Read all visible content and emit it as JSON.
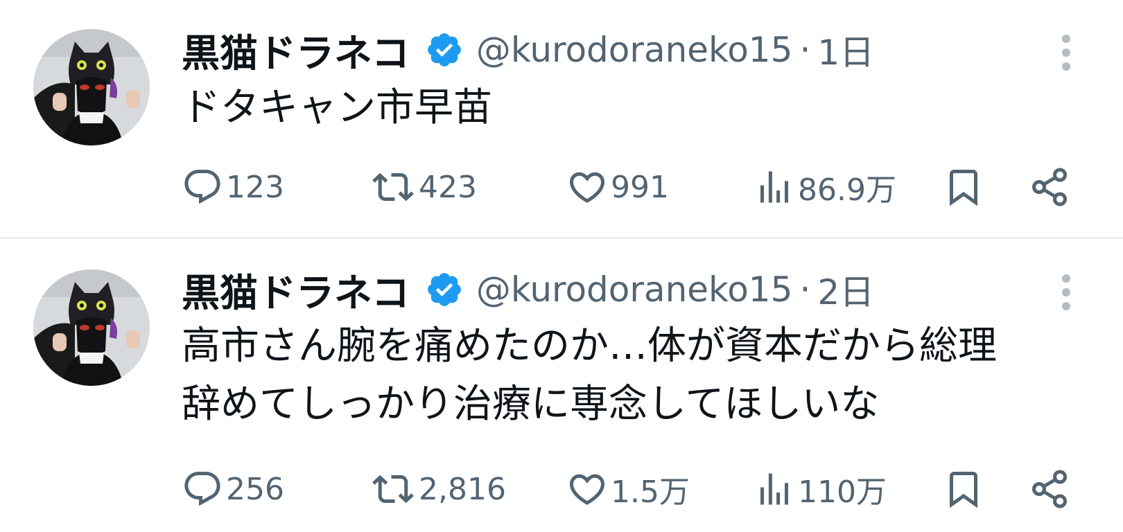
{
  "tweets": [
    {
      "display_name": "黒猫ドラネコ",
      "handle": "@kurodoraneko15",
      "separator": "·",
      "time": "1日",
      "text": "ドタキャン市早苗",
      "replies": "123",
      "retweets": "423",
      "likes": "991",
      "views": "86.9万"
    },
    {
      "display_name": "黒猫ドラネコ",
      "handle": "@kurodoraneko15",
      "separator": "·",
      "time": "2日",
      "text_lines": [
        "高市さん腕を痛めたのか…体が資本だから総理",
        "辞めてしっかり治療に専念してほしいな"
      ],
      "replies": "256",
      "retweets": "2,816",
      "likes": "1.5万",
      "views": "110万"
    }
  ],
  "icons": {
    "verified": "verified-badge-icon",
    "more": "more-vertical-icon",
    "reply": "reply-icon",
    "retweet": "retweet-icon",
    "like": "heart-icon",
    "views": "views-icon",
    "bookmark": "bookmark-icon",
    "share": "share-icon"
  },
  "colors": {
    "text": "#0f1419",
    "secondary": "#536471",
    "verified": "#1d9bf0",
    "divider": "#cfd9de"
  }
}
